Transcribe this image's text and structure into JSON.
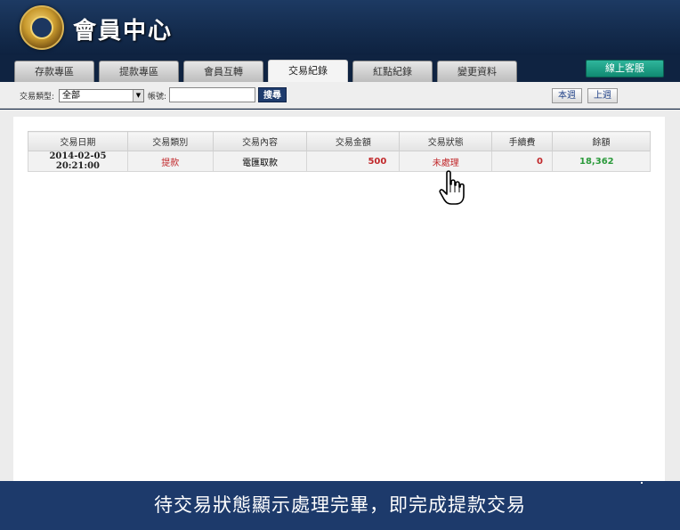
{
  "header": {
    "title": "會員中心"
  },
  "tabs": [
    {
      "label": "存款專區"
    },
    {
      "label": "提款專區"
    },
    {
      "label": "會員互轉"
    },
    {
      "label": "交易紀錄",
      "active": true
    },
    {
      "label": "紅點紀錄"
    },
    {
      "label": "變更資料"
    }
  ],
  "online_service_label": "線上客服",
  "filter": {
    "type_label": "交易類型:",
    "type_value": "全部",
    "account_label": "帳號:",
    "account_value": "",
    "search_label": "搜尋",
    "this_week_label": "本週",
    "last_week_label": "上週"
  },
  "table": {
    "headers": [
      "交易日期",
      "交易類別",
      "交易內容",
      "交易金額",
      "交易狀態",
      "手續費",
      "餘額"
    ],
    "rows": [
      {
        "date": "2014-02-05 20:21:00",
        "category": "提款",
        "content": "電匯取款",
        "amount": "500",
        "status": "未處理",
        "fee": "0",
        "balance": "18,362"
      }
    ]
  },
  "caption": "待交易狀態顯示處理完畢，即完成提款交易",
  "colors": {
    "header_bg": "#142c4e",
    "accent_green": "#108a72",
    "amount_red": "#c1282b",
    "balance_green": "#2b9a3b",
    "caption_bg": "#1d3a6b"
  },
  "icons": {
    "cursor": "hand-pointer-icon",
    "logo": "dragon-logo-icon"
  }
}
